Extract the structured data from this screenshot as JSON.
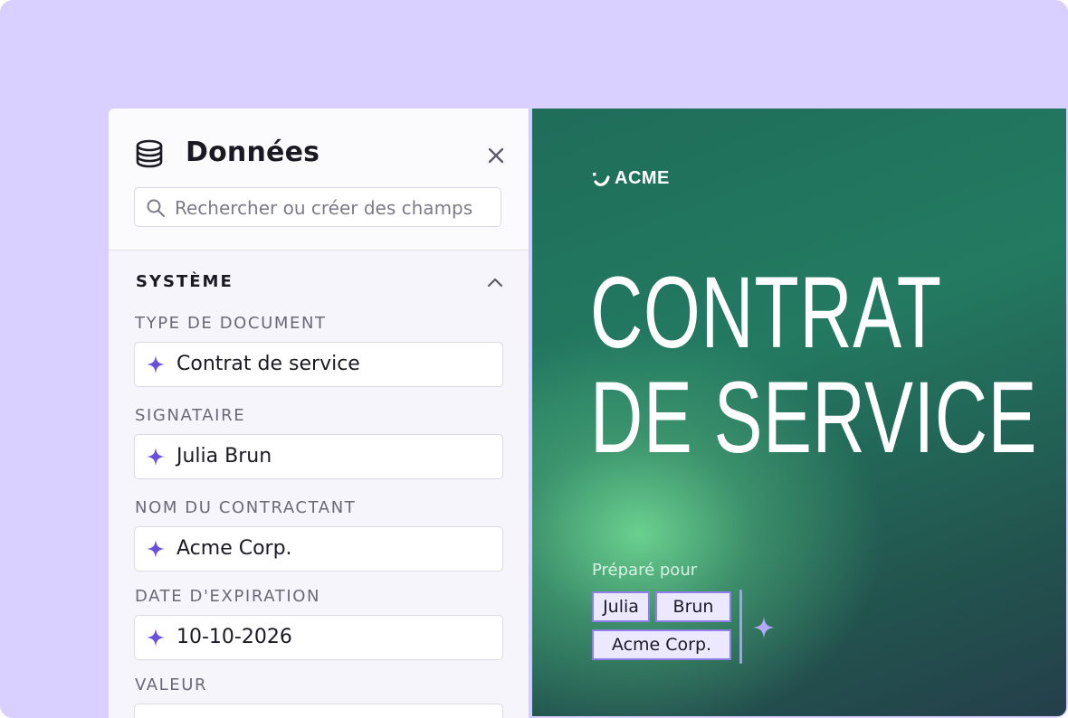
{
  "panel": {
    "title": "Données",
    "icon": "database-icon",
    "close_icon": "close-icon",
    "search": {
      "placeholder": "Rechercher ou créer des champs",
      "value": ""
    },
    "section": {
      "title": "SYSTÈME",
      "collapse_icon": "chevron-up-icon",
      "fields": [
        {
          "label": "TYPE DE DOCUMENT",
          "value": "Contrat de service",
          "icon": "sparkle-icon"
        },
        {
          "label": "SIGNATAIRE",
          "value": "Julia Brun",
          "icon": "sparkle-icon"
        },
        {
          "label": "NOM DU CONTRACTANT",
          "value": "Acme Corp.",
          "icon": "sparkle-icon"
        },
        {
          "label": "DATE D'EXPIRATION",
          "value": "10-10-2026",
          "icon": "sparkle-icon"
        },
        {
          "label": "VALEUR",
          "value": "",
          "icon": "sparkle-icon"
        }
      ]
    }
  },
  "document": {
    "logo_text": "ACME",
    "title_line1": "CONTRAT",
    "title_line2": "DE SERVICE",
    "prepared_label": "Préparé pour",
    "chips": {
      "first_name": "Julia",
      "last_name": "Brun",
      "company": "Acme Corp."
    }
  },
  "colors": {
    "background": "#d9d0ff",
    "accent": "#6a4fd8",
    "doc_green": "#237a61",
    "chip_border": "#8f7ee6"
  }
}
